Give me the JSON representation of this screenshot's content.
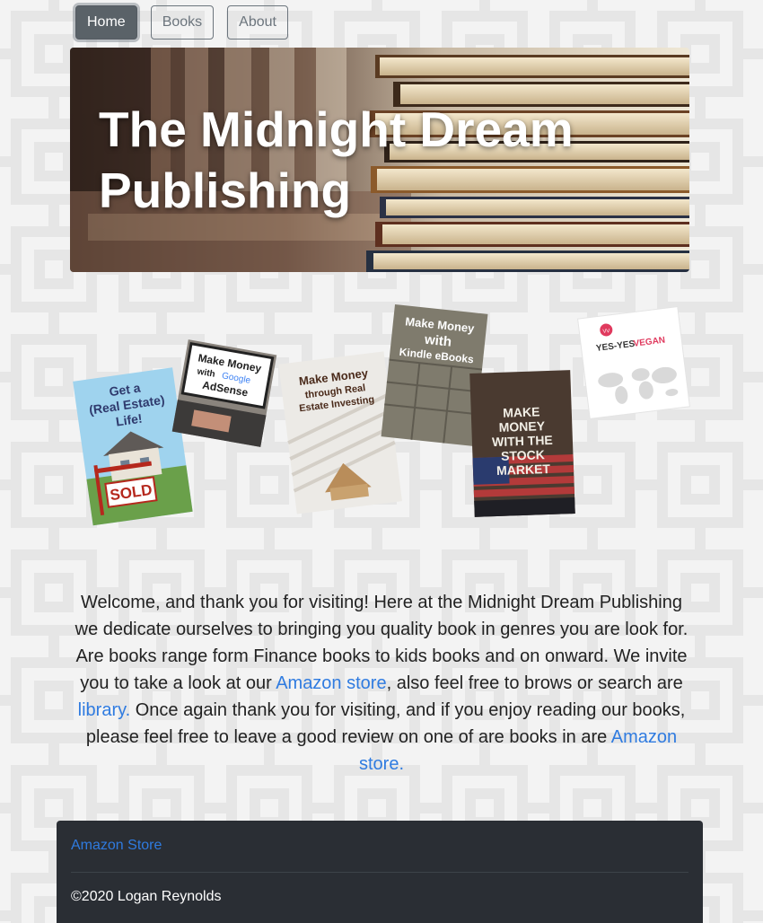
{
  "nav": {
    "home_label": "Home",
    "books_label": "Books",
    "about_label": "About"
  },
  "hero": {
    "title_line1": "The Midnight Dream",
    "title_line2": "Publishing"
  },
  "books": {
    "real_estate_life": {
      "title_l1": "Get a",
      "title_l2": "(Real Estate)",
      "title_l3": "Life!",
      "sign": "SOLD"
    },
    "adsense": {
      "title_l1": "Make Money",
      "title_l2": "with",
      "google": "Google",
      "title_l3": "AdSense"
    },
    "real_estate_investing": {
      "title_l1": "Make Money",
      "title_l2": "through Real",
      "title_l3": "Estate Investing"
    },
    "kindle": {
      "title_l1": "Make Money",
      "title_l2": "with",
      "title_l3": "Kindle eBooks"
    },
    "stock_market": {
      "title_l1": "MAKE",
      "title_l2": "MONEY",
      "title_l3": "WITH THE",
      "title_l4": "STOCK",
      "title_l5": "MARKET"
    },
    "vegan": {
      "title_a": "YES-YES",
      "title_b": "VEGAN",
      "badge": "VV"
    }
  },
  "intro": {
    "p1": "Welcome, and thank you for visiting! Here at the Midnight Dream Publishing we dedicate ourselves to bringing you quality book in genres you are look for. Are books range form Finance books to kids books and on onward. We invite you to take a look at our ",
    "link1": "Amazon store",
    "p2": ", also feel free to brows or search are ",
    "link2": "library.",
    "p3": " Once again thank you for visiting, and if you enjoy reading our books, please feel free to leave a good review on one of are books in are ",
    "link3": "Amazon store."
  },
  "footer": {
    "link": "Amazon Store",
    "copyright": "©2020 Logan Reynolds"
  },
  "colors": {
    "footer_bg": "#2a2e34",
    "link": "#2f7be0",
    "nav_active": "#5a6268",
    "nav_outline": "#6c757d"
  }
}
